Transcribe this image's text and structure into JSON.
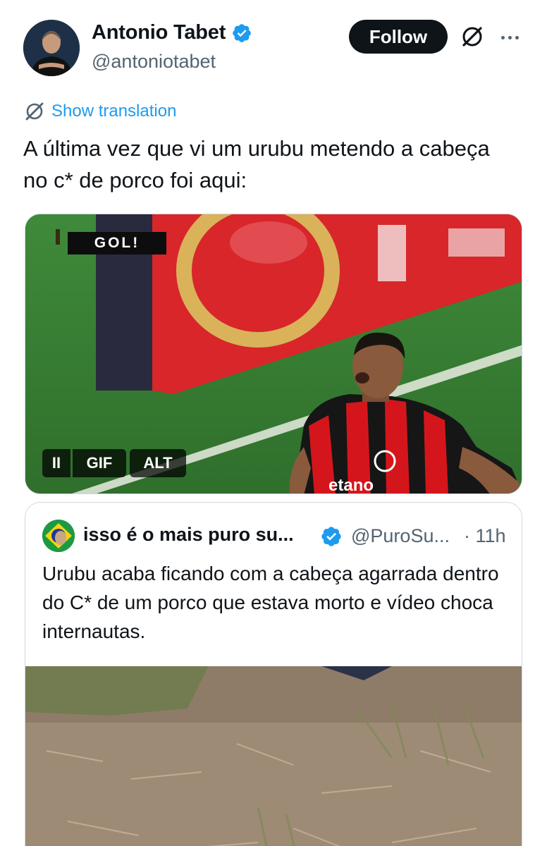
{
  "author": {
    "display_name": "Antonio Tabet",
    "handle": "@antoniotabet",
    "verified": true
  },
  "actions": {
    "follow_label": "Follow",
    "grok_icon": "grok-icon",
    "more_icon": "more-icon"
  },
  "translation": {
    "label": "Show translation"
  },
  "tweet": {
    "text": "A última vez que vi um urubu metendo a cabeça no c* de porco foi aqui:"
  },
  "media": {
    "overlay_badge": "GOL!",
    "jersey_text": "etano",
    "controls": {
      "pause": "II",
      "gif": "GIF",
      "alt": "ALT"
    }
  },
  "quoted": {
    "display_name": "isso é o mais puro su...",
    "handle": "@PuroSu...",
    "time": "· 11h",
    "verified": true,
    "text": "Urubu acaba ficando com a cabeça agarrada dentro do C* de um porco que estava morto e vídeo choca internautas."
  },
  "colors": {
    "accent": "#1d9bf0",
    "text": "#0f1419",
    "secondary": "#536471",
    "border": "#cfd9de",
    "follow_bg": "#0f1419",
    "flamengo_red": "#d4161c"
  }
}
